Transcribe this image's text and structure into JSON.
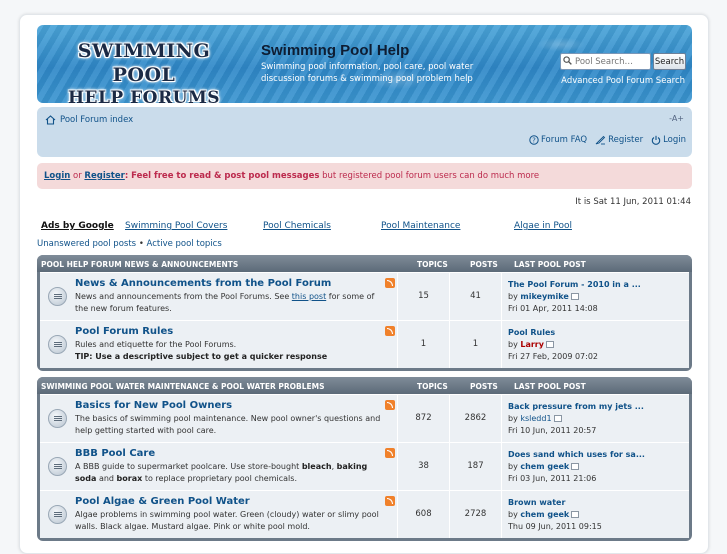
{
  "colors": {
    "accent": "#105289",
    "notice_bg": "#f4dada",
    "forum_head": "#6c7a88"
  },
  "header": {
    "logo_line1": "SWIMMING POOL",
    "logo_line2": "HELP FORUMS",
    "title": "Swimming Pool Help",
    "description": "Swimming pool information, pool care, pool water discussion forums & swimming pool problem help",
    "search_placeholder": "Pool Search…",
    "search_button": "Search",
    "advanced_search": "Advanced Pool Forum Search"
  },
  "navbar": {
    "index_label": "Pool Forum index",
    "font_size": "-A+",
    "faq": "Forum FAQ",
    "register": "Register",
    "login": "Login"
  },
  "notice": {
    "login": "Login",
    "or": "or",
    "register": "Register",
    "bold_text": ": Feel free to read & post pool messages",
    "rest": "but registered pool forum users can do much more"
  },
  "datetime": "It is Sat 11 Jun, 2011 01:44",
  "ads": {
    "label": "Ads by Google",
    "links": [
      "Swimming Pool Covers",
      "Pool Chemicals",
      "Pool Maintenance",
      "Algae in Pool"
    ]
  },
  "quicklinks": {
    "unanswered": "Unanswered pool posts",
    "sep": "•",
    "active": "Active pool topics"
  },
  "categories": [
    {
      "name": "POOL HELP FORUM NEWS & ANNOUNCEMENTS",
      "col_topics": "TOPICS",
      "col_posts": "POSTS",
      "col_last": "LAST POOL POST",
      "forums": [
        {
          "title": "News & Announcements from the Pool Forum",
          "desc_a": "News and announcements from the Pool Forums. See",
          "desc_link": "this post",
          "desc_b": "for some of the new forum features.",
          "topics": "15",
          "posts": "41",
          "last_title": "The Pool Forum - 2010 in a ...",
          "last_by": "by",
          "last_user": "mikeymike",
          "last_time": "Fri 01 Apr, 2011 14:08"
        },
        {
          "title": "Pool Forum Rules",
          "desc_a": "Rules and etiquette for the Pool Forums.",
          "desc_bold": "TIP: Use a descriptive subject to get a quicker response",
          "topics": "1",
          "posts": "1",
          "last_title": "Pool Rules",
          "last_by": "by",
          "last_user": "Larry",
          "last_time": "Fri 27 Feb, 2009 07:02"
        }
      ]
    },
    {
      "name": "SWIMMING POOL WATER MAINTENANCE & POOL WATER PROBLEMS",
      "col_topics": "TOPICS",
      "col_posts": "POSTS",
      "col_last": "LAST POOL POST",
      "forums": [
        {
          "title": "Basics for New Pool Owners",
          "desc_a": "The basics of swimming pool maintenance. New pool owner's questions and help getting started with pool care.",
          "topics": "872",
          "posts": "2862",
          "last_title": "Back pressure from my jets ...",
          "last_by": "by",
          "last_user": "ksledd1",
          "last_time": "Fri 10 Jun, 2011 20:57"
        },
        {
          "title": "BBB Pool Care",
          "desc_a": "A BBB guide to supermarket poolcare. Use store-bought",
          "bold1": "bleach",
          "comma": ",",
          "bold2": "baking soda",
          "and": "and",
          "bold3": "borax",
          "desc_b": "to replace proprietary pool chemicals.",
          "topics": "38",
          "posts": "187",
          "last_title": "Does sand which uses for sa...",
          "last_by": "by",
          "last_user": "chem geek",
          "last_time": "Fri 03 Jun, 2011 21:06"
        },
        {
          "title": "Pool Algae & Green Pool Water",
          "desc_a": "Algae problems in swimming pool water. Green (cloudy) water or slimy pool walls. Black algae. Mustard algae. Pink or white pool mold.",
          "topics": "608",
          "posts": "2728",
          "last_title": "Brown water",
          "last_by": "by",
          "last_user": "chem geek",
          "last_time": "Thu 09 Jun, 2011 09:15"
        }
      ]
    }
  ]
}
